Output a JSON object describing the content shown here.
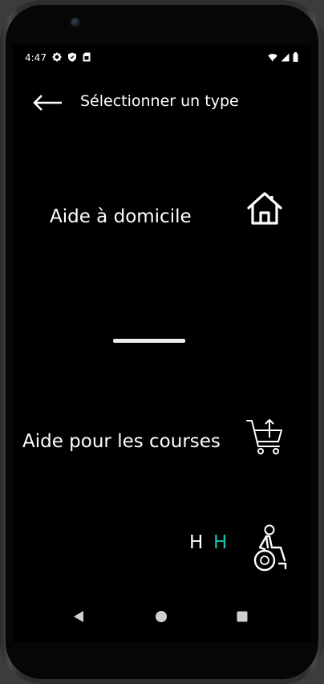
{
  "status_bar": {
    "time": "4:47",
    "left_icons": [
      "gear-icon",
      "shield-icon",
      "sim-card-icon"
    ],
    "right_icons": [
      "wifi-off-icon",
      "signal-icon",
      "battery-icon"
    ]
  },
  "app_bar": {
    "back_icon": "arrow-left-icon",
    "title": "Sélectionner un type"
  },
  "services": [
    {
      "label": "Aide à domicile",
      "icon": "house-icon"
    },
    {
      "label": "Aide pour les courses",
      "icon": "shopping-cart-icon"
    },
    {
      "label": "",
      "icon": "wheelchair-icon"
    }
  ],
  "letters": [
    {
      "text": "H",
      "color": "#ffffff"
    },
    {
      "text": "H",
      "color": "#14c6b2"
    }
  ],
  "nav_bar": {
    "back_icon": "nav-back-icon",
    "home_icon": "nav-home-icon",
    "recents_icon": "nav-recents-icon"
  },
  "colors": {
    "background": "#000000",
    "text": "#ffffff",
    "accent": "#14c6b2"
  }
}
